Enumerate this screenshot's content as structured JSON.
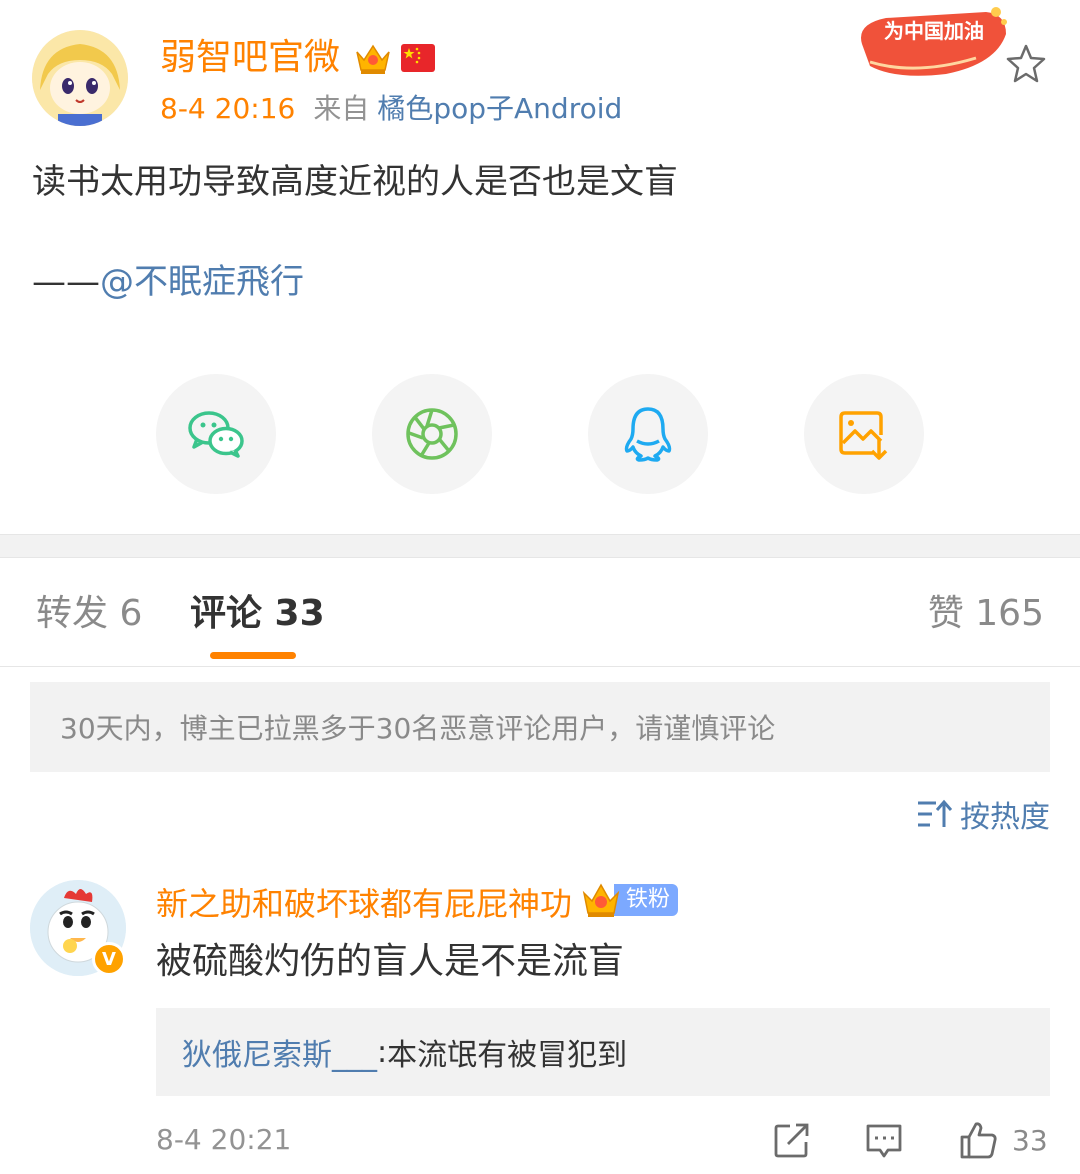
{
  "post": {
    "author": "弱智吧官微",
    "time": "8-4 20:16",
    "from_label": "来自",
    "source": "橘色pop子Android",
    "promo": "为中国加油",
    "text": "读书太用功导致高度近视的人是否也是文盲",
    "attribution_prefix": "——",
    "attribution_mention": "@不眠症飛行"
  },
  "share": {
    "items": [
      "wechat-icon",
      "moments-icon",
      "qq-icon",
      "save-image-icon"
    ]
  },
  "tabs": {
    "repost": "转发 6",
    "comments": "评论 33",
    "likes": "赞 165"
  },
  "notice": "30天内，博主已拉黑多于30名恶意评论用户，请谨慎评论",
  "sort_label": "按热度",
  "comment": {
    "name": "新之助和破坏球都有屁屁神功",
    "verified_mark": "V",
    "fan_badge": "铁粉",
    "text": "被硫酸灼伤的盲人是不是流盲",
    "reply_name": "狄俄尼索斯___",
    "reply_sep": ":",
    "reply_text": " 本流氓有被冒犯到",
    "time": "8-4 20:21",
    "likes": "33"
  },
  "colors": {
    "accent": "#ff8200",
    "link": "#507daf",
    "text": "#333333",
    "muted": "#939393"
  }
}
